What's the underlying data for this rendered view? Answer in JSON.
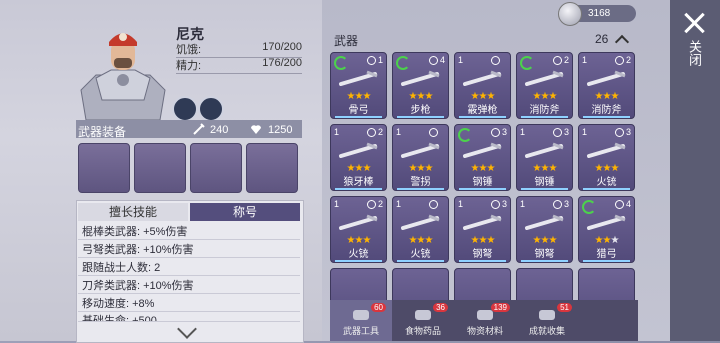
{
  "close": {
    "label": "关闭"
  },
  "coins": {
    "value": "3168"
  },
  "character": {
    "name": "尼克",
    "stats": [
      {
        "label": "饥饿:",
        "value": "170/200"
      },
      {
        "label": "精力:",
        "value": "176/200"
      }
    ]
  },
  "equipment": {
    "title": "武器装备",
    "attack": "240",
    "defense": "1250"
  },
  "skills": {
    "tabs": [
      "擅长技能",
      "称号"
    ],
    "rows": [
      "棍棒类武器: +5%伤害",
      "弓弩类武器: +10%伤害",
      "跟随战士人数: 2",
      "刀斧类武器: +10%伤害",
      "移动速度: +8%",
      "基础生命: +500"
    ]
  },
  "weapons": {
    "title": "武器",
    "count": "26",
    "items": [
      {
        "q": "1",
        "lv": "1",
        "name": "骨弓",
        "stars": 3,
        "recycle": true
      },
      {
        "q": "1",
        "lv": "4",
        "name": "步枪",
        "stars": 3,
        "recycle": true
      },
      {
        "q": "1",
        "lv": "",
        "name": "霰弹枪",
        "stars": 3,
        "recycle": false
      },
      {
        "q": "1",
        "lv": "2",
        "name": "消防斧",
        "stars": 3,
        "recycle": true
      },
      {
        "q": "1",
        "lv": "2",
        "name": "消防斧",
        "stars": 3,
        "recycle": false
      },
      {
        "q": "1",
        "lv": "2",
        "name": "狼牙棒",
        "stars": 3,
        "recycle": false
      },
      {
        "q": "1",
        "lv": "",
        "name": "警拐",
        "stars": 3,
        "recycle": false
      },
      {
        "q": "1",
        "lv": "3",
        "name": "钢锤",
        "stars": 3,
        "recycle": true
      },
      {
        "q": "1",
        "lv": "3",
        "name": "钢锤",
        "stars": 3,
        "recycle": false
      },
      {
        "q": "1",
        "lv": "3",
        "name": "火铳",
        "stars": 3,
        "recycle": false
      },
      {
        "q": "1",
        "lv": "2",
        "name": "火铳",
        "stars": 3,
        "recycle": false
      },
      {
        "q": "1",
        "lv": "",
        "name": "火铳",
        "stars": 3,
        "recycle": false
      },
      {
        "q": "1",
        "lv": "3",
        "name": "钢弩",
        "stars": 3,
        "recycle": false
      },
      {
        "q": "1",
        "lv": "3",
        "name": "钢弩",
        "stars": 3,
        "recycle": false
      },
      {
        "q": "1",
        "lv": "4",
        "name": "猎弓",
        "stars": 2,
        "recycle": true
      }
    ]
  },
  "bottom_tabs": [
    {
      "label": "武器工具",
      "count": "60"
    },
    {
      "label": "食物药品",
      "count": "36"
    },
    {
      "label": "物资材料",
      "count": "139"
    },
    {
      "label": "成就收集",
      "count": "51"
    }
  ]
}
